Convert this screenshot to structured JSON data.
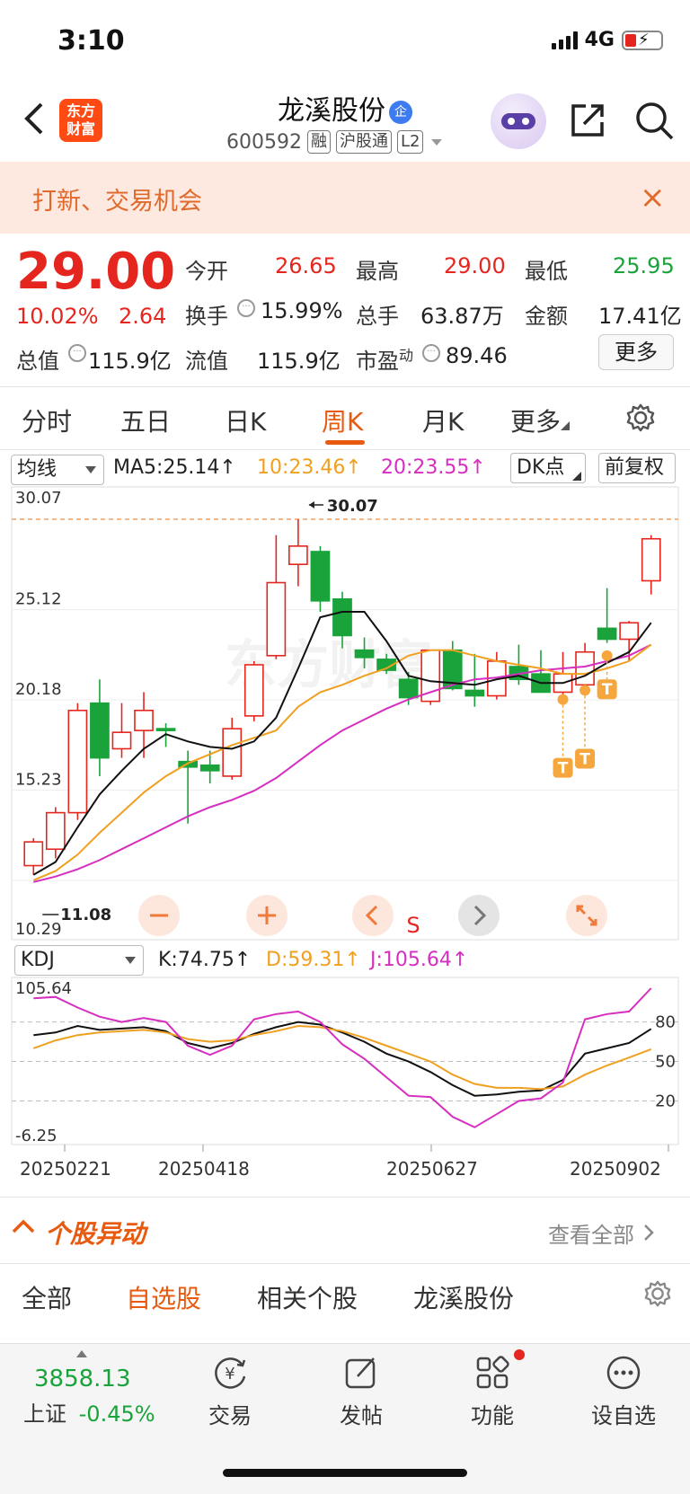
{
  "status": {
    "time": "3:10",
    "network": "4G"
  },
  "header": {
    "back_icon": "chevron-left-icon",
    "logo_line1": "东方",
    "logo_line2": "财富",
    "title": "龙溪股份",
    "title_badge": "企",
    "code": "600592",
    "tags": [
      "融",
      "沪股通",
      "L2"
    ]
  },
  "notice": {
    "text": "打新、交易机会",
    "close": "×"
  },
  "quote": {
    "price": "29.00",
    "change_pct": "10.02%",
    "change": "2.64",
    "rows": [
      [
        {
          "label": "今开",
          "value": "26.65",
          "color": "red"
        },
        {
          "label": "最高",
          "value": "29.00",
          "color": "red"
        },
        {
          "label": "最低",
          "value": "25.95",
          "color": "green"
        }
      ],
      [
        {
          "label": "换手",
          "value": "15.99%",
          "color": "dark"
        },
        {
          "label": "总手",
          "value": "63.87万",
          "color": "dark"
        },
        {
          "label": "金额",
          "value": "17.41亿",
          "color": "dark"
        }
      ],
      [
        {
          "label": "总值",
          "value": "115.9亿",
          "color": "dark"
        },
        {
          "label": "流值",
          "value": "115.9亿",
          "color": "dark"
        },
        {
          "label": "市盈",
          "sup": "动",
          "value": "89.46",
          "color": "dark"
        }
      ]
    ],
    "more": "更多"
  },
  "period_tabs": [
    "分时",
    "五日",
    "日K",
    "周K",
    "月K",
    "更多"
  ],
  "active_period": "周K",
  "ma_bar": {
    "select": "均线",
    "ma5": "MA5:25.14↑",
    "ma10": "10:23.46↑",
    "ma20": "20:23.55↑",
    "dk": "DK点",
    "fq": "前复权"
  },
  "kdj_bar": {
    "select": "KDJ",
    "k": "K:74.75↑",
    "d": "D:59.31↑",
    "j": "J:105.64↑"
  },
  "colors": {
    "up": "#e5261f",
    "down": "#1aa33a",
    "accent": "#e85a10",
    "ma5": "#111111",
    "ma10": "#f0a020",
    "ma20": "#d62ec0"
  },
  "chart_data": [
    {
      "type": "candlestick",
      "y_ticks": [
        "30.07",
        "25.12",
        "20.18",
        "15.23",
        "10.29"
      ],
      "ylim": [
        10.29,
        30.07
      ],
      "max_label": "30.07",
      "min_label": "11.08",
      "s_marker": "S",
      "t_marker": "T",
      "x_ticks": [
        "20250221",
        "20250418",
        "20250627",
        "20250902"
      ],
      "candles": [
        {
          "o": 11.1,
          "h": 12.6,
          "l": 10.6,
          "c": 12.4
        },
        {
          "o": 12.0,
          "h": 14.3,
          "l": 11.5,
          "c": 14.0
        },
        {
          "o": 14.0,
          "h": 20.0,
          "l": 13.6,
          "c": 19.6
        },
        {
          "o": 20.0,
          "h": 21.3,
          "l": 16.0,
          "c": 17.0
        },
        {
          "o": 17.5,
          "h": 20.0,
          "l": 17.0,
          "c": 18.4
        },
        {
          "o": 18.5,
          "h": 20.6,
          "l": 17.0,
          "c": 19.6
        },
        {
          "o": 18.6,
          "h": 18.9,
          "l": 17.6,
          "c": 18.5
        },
        {
          "o": 16.8,
          "h": 17.4,
          "l": 13.4,
          "c": 16.5
        },
        {
          "o": 16.6,
          "h": 17.4,
          "l": 15.6,
          "c": 16.3
        },
        {
          "o": 16.0,
          "h": 19.2,
          "l": 15.8,
          "c": 18.6
        },
        {
          "o": 19.3,
          "h": 22.3,
          "l": 19.0,
          "c": 22.1
        },
        {
          "o": 22.6,
          "h": 29.2,
          "l": 22.4,
          "c": 26.6
        },
        {
          "o": 27.6,
          "h": 30.07,
          "l": 26.4,
          "c": 28.6
        },
        {
          "o": 28.3,
          "h": 28.6,
          "l": 25.0,
          "c": 25.6
        },
        {
          "o": 25.7,
          "h": 26.1,
          "l": 23.0,
          "c": 23.7
        },
        {
          "o": 22.9,
          "h": 23.6,
          "l": 21.9,
          "c": 22.5
        },
        {
          "o": 22.4,
          "h": 22.7,
          "l": 21.6,
          "c": 21.8
        },
        {
          "o": 21.3,
          "h": 21.7,
          "l": 19.9,
          "c": 20.3
        },
        {
          "o": 20.1,
          "h": 22.8,
          "l": 19.9,
          "c": 22.9
        },
        {
          "o": 22.9,
          "h": 23.4,
          "l": 20.7,
          "c": 20.8
        },
        {
          "o": 20.7,
          "h": 22.7,
          "l": 19.8,
          "c": 20.4
        },
        {
          "o": 20.4,
          "h": 22.8,
          "l": 20.2,
          "c": 22.3
        },
        {
          "o": 22.0,
          "h": 23.2,
          "l": 21.0,
          "c": 21.3
        },
        {
          "o": 21.6,
          "h": 22.9,
          "l": 20.6,
          "c": 20.6
        },
        {
          "o": 20.6,
          "h": 22.8,
          "l": 20.4,
          "c": 21.6
        },
        {
          "o": 21.0,
          "h": 23.3,
          "l": 21.0,
          "c": 22.8
        },
        {
          "o": 24.1,
          "h": 26.3,
          "l": 23.3,
          "c": 23.5
        },
        {
          "o": 23.5,
          "h": 24.5,
          "l": 22.3,
          "c": 24.4
        },
        {
          "o": 26.7,
          "h": 29.2,
          "l": 25.95,
          "c": 29.0
        }
      ],
      "ma5": [
        10.6,
        11.3,
        13.2,
        15.0,
        16.3,
        17.5,
        18.3,
        17.9,
        17.6,
        17.5,
        17.9,
        19.2,
        21.9,
        24.7,
        25.0,
        25.0,
        23.4,
        21.5,
        21.2,
        21.1,
        21.0,
        21.3,
        21.5,
        21.1,
        21.1,
        21.5,
        22.2,
        22.8,
        24.4
      ],
      "ma10": [
        10.3,
        10.8,
        11.7,
        12.9,
        14.0,
        15.1,
        16.0,
        16.7,
        17.2,
        17.7,
        18.1,
        18.5,
        19.8,
        20.6,
        21.0,
        21.5,
        21.9,
        22.6,
        22.9,
        22.9,
        22.6,
        22.3,
        22.1,
        21.9,
        21.6,
        21.6,
        21.9,
        22.3,
        23.2
      ],
      "ma20": [
        10.2,
        10.5,
        10.9,
        11.4,
        12.0,
        12.6,
        13.2,
        13.8,
        14.3,
        14.7,
        15.2,
        15.9,
        16.8,
        17.7,
        18.5,
        19.1,
        19.7,
        20.2,
        20.6,
        21.0,
        21.3,
        21.4,
        21.6,
        21.8,
        21.9,
        22.0,
        22.3,
        22.6,
        23.2
      ],
      "t_points": [
        {
          "i": 24,
          "v": 20.2,
          "t": 17.0
        },
        {
          "i": 25,
          "v": 20.7,
          "t": 17.5
        },
        {
          "i": 26,
          "v": 22.6,
          "t": 21.3
        }
      ]
    },
    {
      "type": "line",
      "y_labels_left": [
        "105.64",
        "-6.25"
      ],
      "y_labels_right": [
        "80",
        "50",
        "20"
      ],
      "ylim": [
        -6.25,
        105.64
      ],
      "series": [
        {
          "name": "K",
          "values": [
            70,
            72,
            77,
            74,
            75,
            76,
            73,
            64,
            60,
            64,
            71,
            76,
            80,
            78,
            72,
            65,
            56,
            50,
            42,
            32,
            24,
            25,
            27,
            28,
            36,
            56,
            60,
            64,
            74.75
          ]
        },
        {
          "name": "D",
          "values": [
            60,
            66,
            70,
            72,
            73,
            74,
            72,
            67,
            65,
            66,
            70,
            73,
            77,
            76,
            73,
            68,
            62,
            56,
            50,
            40,
            33,
            30,
            30,
            29,
            31,
            40,
            47,
            53,
            59.31
          ]
        },
        {
          "name": "J",
          "values": [
            98,
            99,
            91,
            84,
            80,
            83,
            80,
            62,
            55,
            62,
            82,
            86,
            88,
            80,
            63,
            52,
            38,
            24,
            23,
            8,
            0,
            10,
            20,
            22,
            34,
            82,
            86,
            88,
            105.64
          ]
        }
      ]
    }
  ],
  "chart_controls": [
    "minus-icon",
    "plus-icon",
    "chevron-left-icon",
    "chevron-right-icon",
    "expand-icon"
  ],
  "yidong": {
    "title": "个股异动",
    "view_all": "查看全部"
  },
  "filter_tabs": [
    "全部",
    "自选股",
    "相关个股",
    "龙溪股份"
  ],
  "active_filter": "自选股",
  "bottom": {
    "index_value": "3858.13",
    "index_label": "上证",
    "index_change": "-0.45%",
    "nav": [
      "交易",
      "发帖",
      "功能",
      "设自选"
    ]
  }
}
